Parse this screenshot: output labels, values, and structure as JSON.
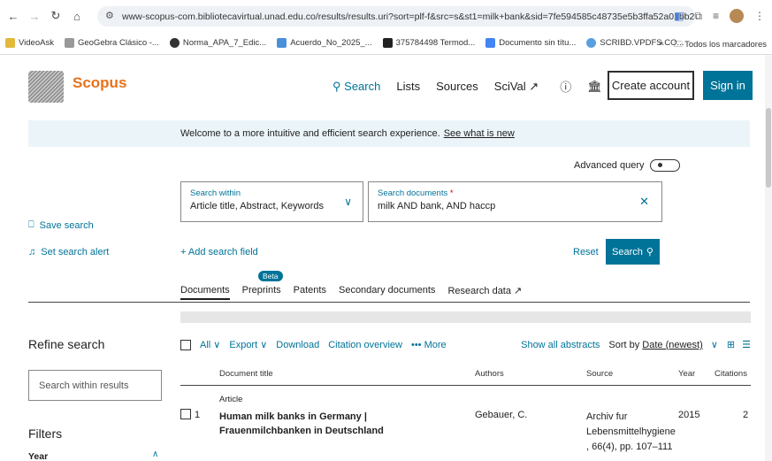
{
  "browser": {
    "url": "www-scopus-com.bibliotecavirtual.unad.edu.co/results/results.uri?sort=plf-f&src=s&st1=milk+bank&sid=7fe594585c48735e5b3ffa52a01bb2b1&so...",
    "bookmarks": [
      "VideoAsk",
      "GeoGebra Clásico -...",
      "Norma_APA_7_Edic...",
      "Acuerdo_No_2025_...",
      "375784498 Termod...",
      "Documento sin títu...",
      "SCRIBD.VPDFS.CO..."
    ],
    "bookmarks_more": "»",
    "all_bookmarks": "Todos los marcadores"
  },
  "header": {
    "brand": "Scopus",
    "nav": {
      "search": "Search",
      "lists": "Lists",
      "sources": "Sources",
      "scival": "SciVal ↗"
    },
    "create_account": "Create account",
    "sign_in": "Sign in"
  },
  "welcome": {
    "text": "Welcome to a more intuitive and efficient search experience.",
    "link": "See what is new"
  },
  "search": {
    "advanced_query": "Advanced query",
    "within_label": "Search within",
    "within_value": "Article title, Abstract, Keywords",
    "docs_label": "Search documents",
    "docs_required": "*",
    "docs_value": "milk AND bank, AND haccp",
    "add_field": "+ Add search field",
    "reset": "Reset",
    "search_button": "Search"
  },
  "left": {
    "save_search": "Save search",
    "set_alert": "Set search alert",
    "refine": "Refine search",
    "search_within_results": "Search within results",
    "filters": "Filters",
    "year": "Year"
  },
  "tabs": {
    "documents": "Documents",
    "preprints": "Preprints",
    "beta": "Beta",
    "patents": "Patents",
    "secondary": "Secondary documents",
    "research": "Research data ↗"
  },
  "toolbar": {
    "all": "All",
    "export": "Export",
    "download": "Download",
    "citation_overview": "Citation overview",
    "more": "••• More",
    "show_abstracts": "Show all abstracts",
    "sort_by": "Sort by",
    "sort_value": "Date (newest)"
  },
  "columns": {
    "title": "Document title",
    "authors": "Authors",
    "source": "Source",
    "year": "Year",
    "citations": "Citations"
  },
  "results": [
    {
      "type": "Article",
      "num": "1",
      "title": "Human milk banks in Germany | Frauenmilchbanken in Deutschland",
      "author": "Gebauer, C.",
      "source": "Archiv fur Lebensmittelhygiene , 66(4), pp. 107–111",
      "year": "2015",
      "citations": "2"
    }
  ]
}
